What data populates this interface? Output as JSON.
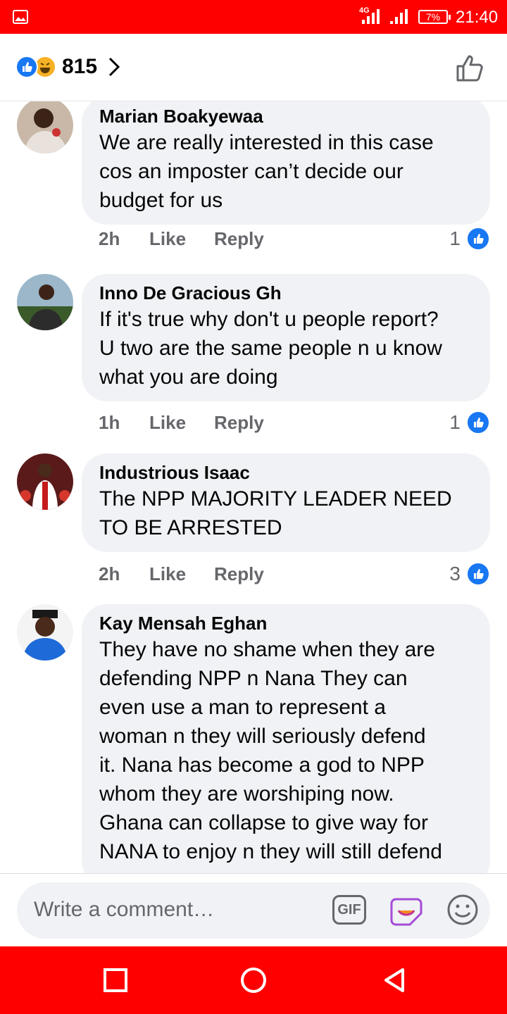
{
  "status_bar": {
    "network": "4G",
    "battery": "7%",
    "time": "21:40",
    "bg_color": "#ff0000",
    "icons": [
      "image-icon",
      "signal-icon",
      "signal-icon",
      "battery-icon"
    ]
  },
  "header": {
    "reaction_count": "815",
    "reactions": [
      "like-reaction-icon",
      "haha-reaction-icon"
    ],
    "like_icon": "thumbs-up-outline-icon"
  },
  "comments": [
    {
      "author": "Marian Boakyewaa",
      "lines": [
        "We are really interested in this case",
        "cos an imposter can’t decide our",
        "budget for us"
      ],
      "time": "2h",
      "like_label": "Like",
      "reply_label": "Reply",
      "reactions": "1"
    },
    {
      "author": "Inno De Gracious Gh",
      "lines": [
        "If it's true why don't u people report?",
        "U two are the same people n u know",
        "what you are doing"
      ],
      "time": "1h",
      "like_label": "Like",
      "reply_label": "Reply",
      "reactions": "1"
    },
    {
      "author": "Industrious Isaac",
      "lines": [
        "The NPP MAJORITY LEADER NEED",
        "TO BE ARRESTED"
      ],
      "time": "2h",
      "like_label": "Like",
      "reply_label": "Reply",
      "reactions": "3"
    },
    {
      "author": "Kay Mensah Eghan",
      "lines": [
        "They have no shame when they are",
        "defending NPP n Nana They can",
        "even use a man to represent a",
        "woman n they will seriously defend",
        "it. Nana has become a god to NPP",
        "whom they are worshiping now.",
        "Ghana can collapse to give way for",
        "NANA to enjoy n they will still defend"
      ]
    }
  ],
  "composer": {
    "placeholder": "Write a comment…",
    "gif_label": "GIF"
  },
  "nav": {
    "icons": [
      "recent-apps-icon",
      "home-icon",
      "back-icon"
    ],
    "bg_color": "#ff0000"
  }
}
